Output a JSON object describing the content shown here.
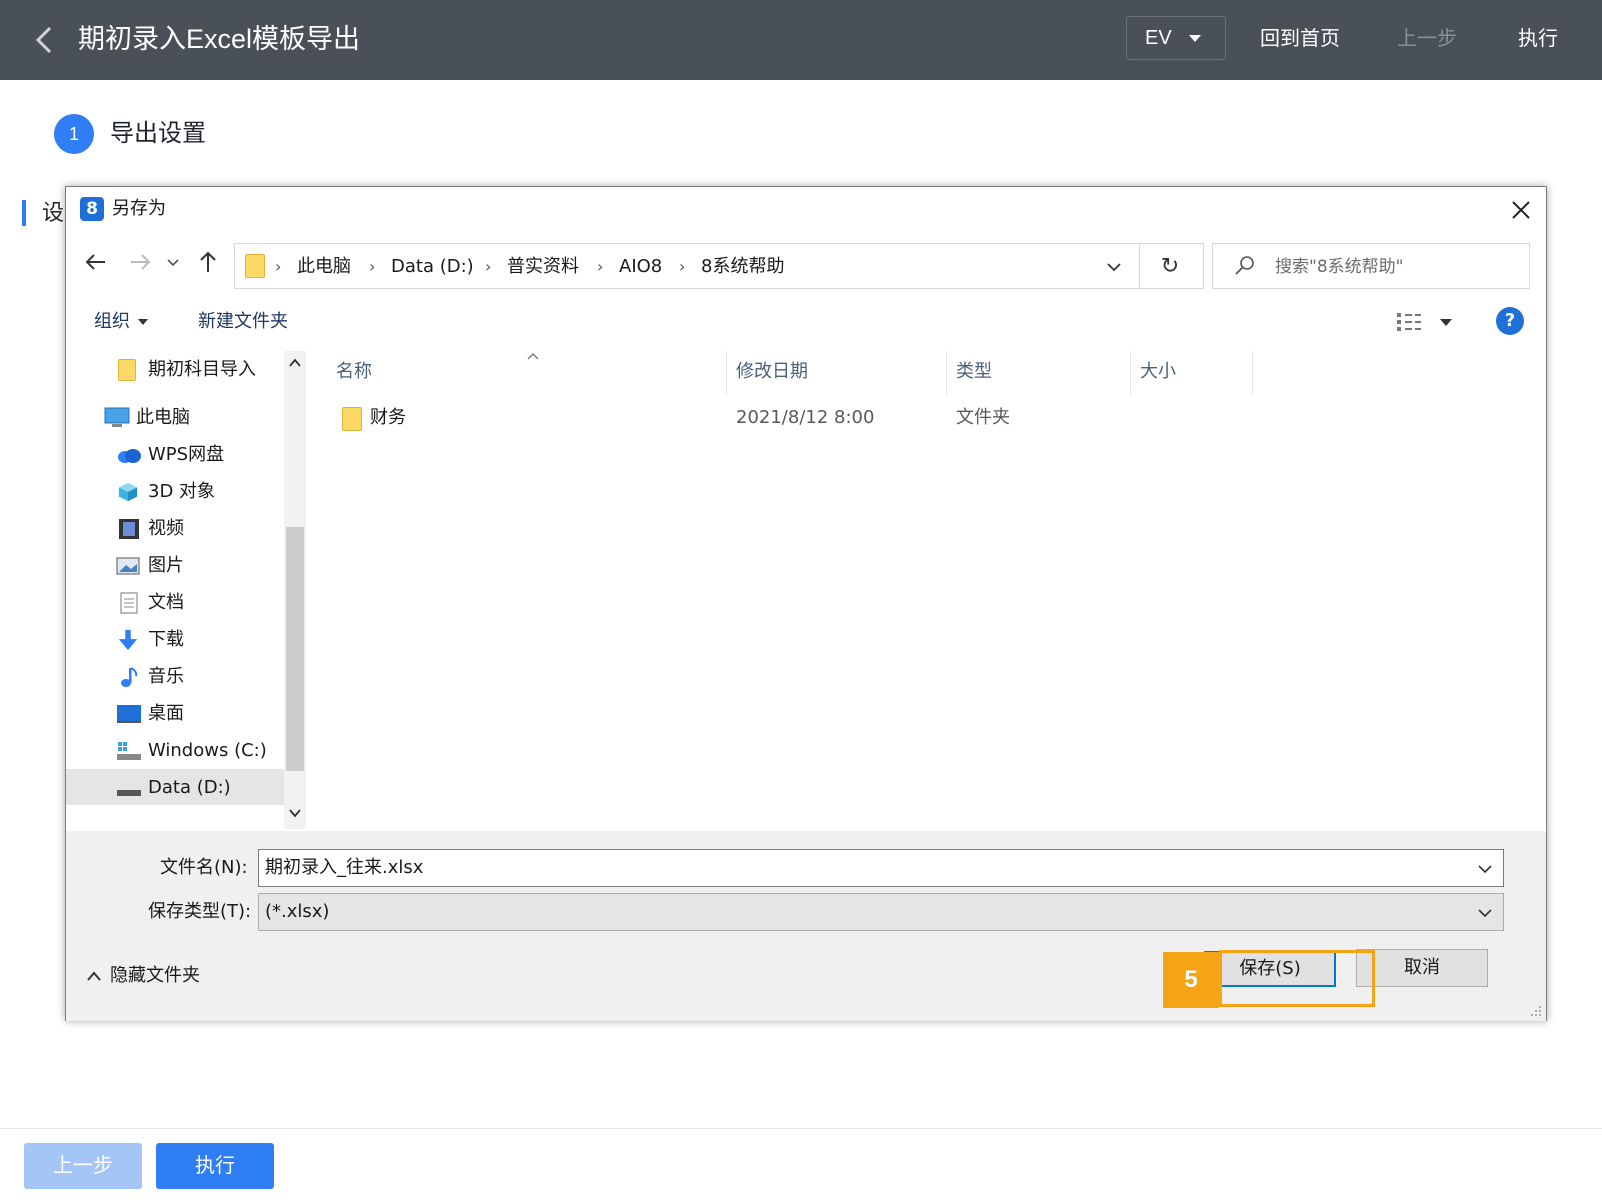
{
  "header": {
    "title": "期初录入Excel模板导出",
    "ev_label": "EV",
    "home_label": "回到首页",
    "prev_label": "上一步",
    "exec_label": "执行"
  },
  "steps": {
    "number": "1",
    "label": "导出设置",
    "section_label": "设"
  },
  "bottom": {
    "prev_label": "上一步",
    "exec_label": "执行"
  },
  "dialog": {
    "title": "另存为",
    "breadcrumb": [
      "此电脑",
      "Data (D:)",
      "普实资料",
      "AIO8",
      "8系统帮助"
    ],
    "search_placeholder": "搜索\"8系统帮助\"",
    "toolbar": {
      "organize": "组织",
      "new_folder": "新建文件夹"
    },
    "nav_items": [
      {
        "label": "期初科目导入",
        "icon": "folder-icon"
      },
      {
        "label": "此电脑",
        "icon": "computer-icon"
      },
      {
        "label": "WPS网盘",
        "icon": "cloud-icon"
      },
      {
        "label": "3D 对象",
        "icon": "cube-icon"
      },
      {
        "label": "视频",
        "icon": "video-icon"
      },
      {
        "label": "图片",
        "icon": "picture-icon"
      },
      {
        "label": "文档",
        "icon": "document-icon"
      },
      {
        "label": "下载",
        "icon": "download-icon"
      },
      {
        "label": "音乐",
        "icon": "music-icon"
      },
      {
        "label": "桌面",
        "icon": "desktop-icon"
      },
      {
        "label": "Windows (C:)",
        "icon": "drive-c-icon"
      },
      {
        "label": "Data (D:)",
        "icon": "drive-d-icon"
      }
    ],
    "columns": {
      "name": "名称",
      "date": "修改日期",
      "type": "类型",
      "size": "大小"
    },
    "files": [
      {
        "name": "财务",
        "date": "2021/8/12 8:00",
        "type": "文件夹",
        "size": ""
      }
    ],
    "filename_label": "文件名(N):",
    "filename_value": "期初录入_往来.xlsx",
    "filetype_label": "保存类型(T):",
    "filetype_value": "(*.xlsx)",
    "hide_folders": "隐藏文件夹",
    "save_label": "保存(S)",
    "cancel_label": "取消"
  },
  "annotation": {
    "number": "5",
    "color": "#f5a416"
  },
  "colors": {
    "header_bg": "#4a5058",
    "accent": "#2f7ef5",
    "annotation": "#f5a416"
  }
}
